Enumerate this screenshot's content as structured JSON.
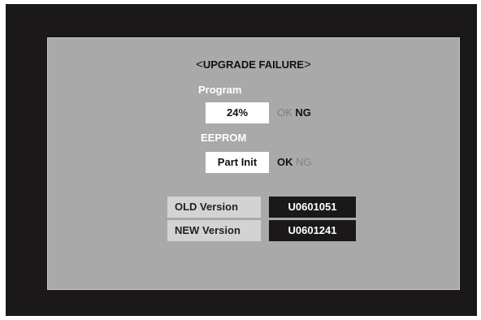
{
  "title": {
    "left_bracket": "<",
    "text": "UPGRADE FAILURE",
    "right_bracket": ">"
  },
  "program": {
    "label": "Program",
    "value": "24%",
    "ok": "OK",
    "ng": "NG",
    "status": "NG"
  },
  "eeprom": {
    "label": "EEPROM",
    "value": "Part Init",
    "ok": "OK",
    "ng": "NG",
    "status": "OK"
  },
  "versions": {
    "old_label": "OLD Version",
    "old_value": "U0601051",
    "new_label": "NEW Version",
    "new_value": "U0601241"
  },
  "colors": {
    "outer_background": "#1a1818",
    "panel_background": "#a9a9a9",
    "value_box": "#ffffff",
    "version_label_bg": "#d3d3d3",
    "version_value_bg": "#1a1818"
  }
}
